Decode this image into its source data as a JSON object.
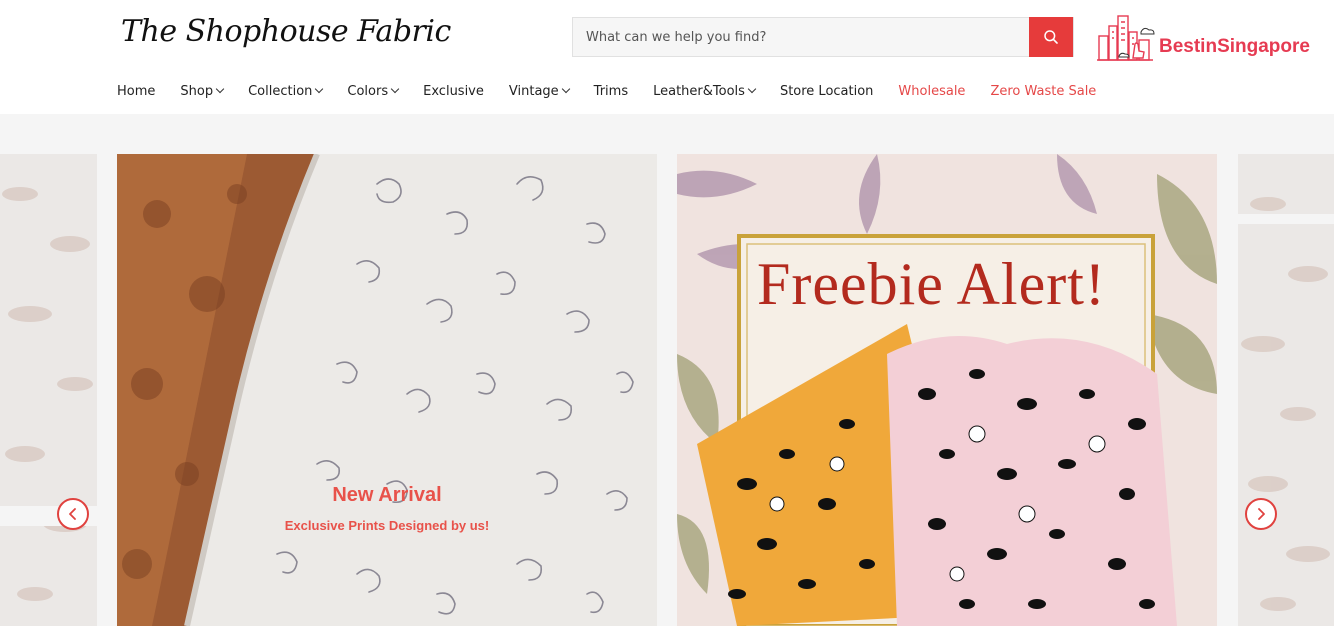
{
  "header": {
    "logo_text": "The Shophouse Fabric",
    "search": {
      "placeholder": "What can we help you find?",
      "value": ""
    },
    "badge": {
      "text": "BestinSingapore"
    }
  },
  "nav": {
    "items": [
      {
        "label": "Home",
        "dropdown": false
      },
      {
        "label": "Shop",
        "dropdown": true
      },
      {
        "label": "Collection",
        "dropdown": true
      },
      {
        "label": "Colors",
        "dropdown": true
      },
      {
        "label": "Exclusive",
        "dropdown": false
      },
      {
        "label": "Vintage",
        "dropdown": true
      },
      {
        "label": "Trims",
        "dropdown": false
      },
      {
        "label": "Leather&Tools",
        "dropdown": true
      },
      {
        "label": "Store Location",
        "dropdown": false
      },
      {
        "label": "Wholesale",
        "dropdown": false,
        "highlight": true
      },
      {
        "label": "Zero Waste Sale",
        "dropdown": false,
        "highlight": true
      }
    ]
  },
  "carousel": {
    "slides": [
      {
        "caption_title": "New Arrival",
        "caption_sub": "Exclusive Prints Designed by us!"
      },
      {
        "caption_title": "Freebie Alert!"
      }
    ]
  },
  "colors": {
    "accent": "#e63b3b",
    "nav_highlight": "#e54848",
    "caption": "#e8524a",
    "alert_title": "#b32a1e"
  },
  "icons": {
    "search": "search-icon",
    "prev": "chevron-left-icon",
    "next": "chevron-right-icon",
    "dropdown": "chevron-down-icon"
  }
}
